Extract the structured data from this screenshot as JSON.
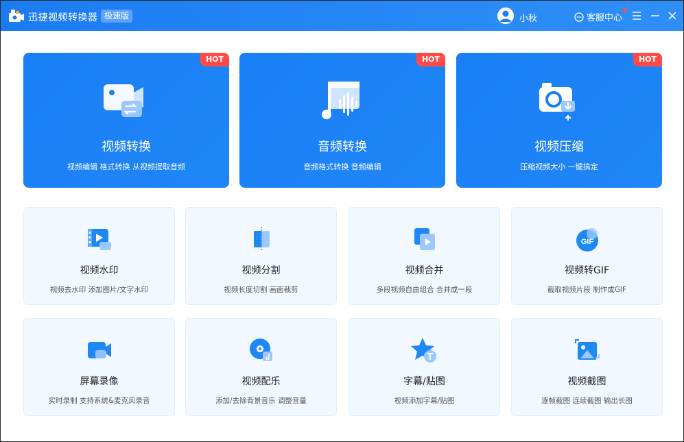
{
  "titlebar": {
    "app_title": "迅捷视频转换器",
    "edition": "极速版",
    "username": "小秋",
    "support_label": "客服中心"
  },
  "big_cards": [
    {
      "title": "视频转换",
      "desc": "视频编辑 格式转换 从视频提取音频",
      "badge": "HOT",
      "icon": "video-convert-icon"
    },
    {
      "title": "音频转换",
      "desc": "音频格式转换 音频编辑",
      "badge": "HOT",
      "icon": "audio-convert-icon"
    },
    {
      "title": "视频压缩",
      "desc": "压缩视频大小 一键搞定",
      "badge": "HOT",
      "icon": "video-compress-icon"
    }
  ],
  "tools": [
    {
      "title": "视频水印",
      "desc": "视频去水印 添加图片/文字水印",
      "icon": "watermark-icon"
    },
    {
      "title": "视频分割",
      "desc": "视频长度切割 画面裁剪",
      "icon": "split-icon"
    },
    {
      "title": "视频合并",
      "desc": "多段视频自由组合 合并成一段",
      "icon": "merge-icon"
    },
    {
      "title": "视频转GIF",
      "desc": "截取视频片段 制作成GIF",
      "icon": "gif-icon",
      "icon_text": "GIF"
    },
    {
      "title": "屏幕录像",
      "desc": "实时录制 支持系统&麦克风录音",
      "icon": "screen-record-icon"
    },
    {
      "title": "视频配乐",
      "desc": "添加/去除背景音乐 调整音量",
      "icon": "music-icon"
    },
    {
      "title": "字幕/贴图",
      "desc": "视频添加字幕/贴图",
      "icon": "subtitle-icon"
    },
    {
      "title": "视频截图",
      "desc": "逐帧截图 连续截图 输出长图",
      "icon": "screenshot-icon"
    }
  ],
  "colors": {
    "titlebar": "#1b7cf2",
    "card_blue": "#1a7ff5",
    "hot_badge": "#ff4b47",
    "tool_bg": "#f2f8ff"
  }
}
